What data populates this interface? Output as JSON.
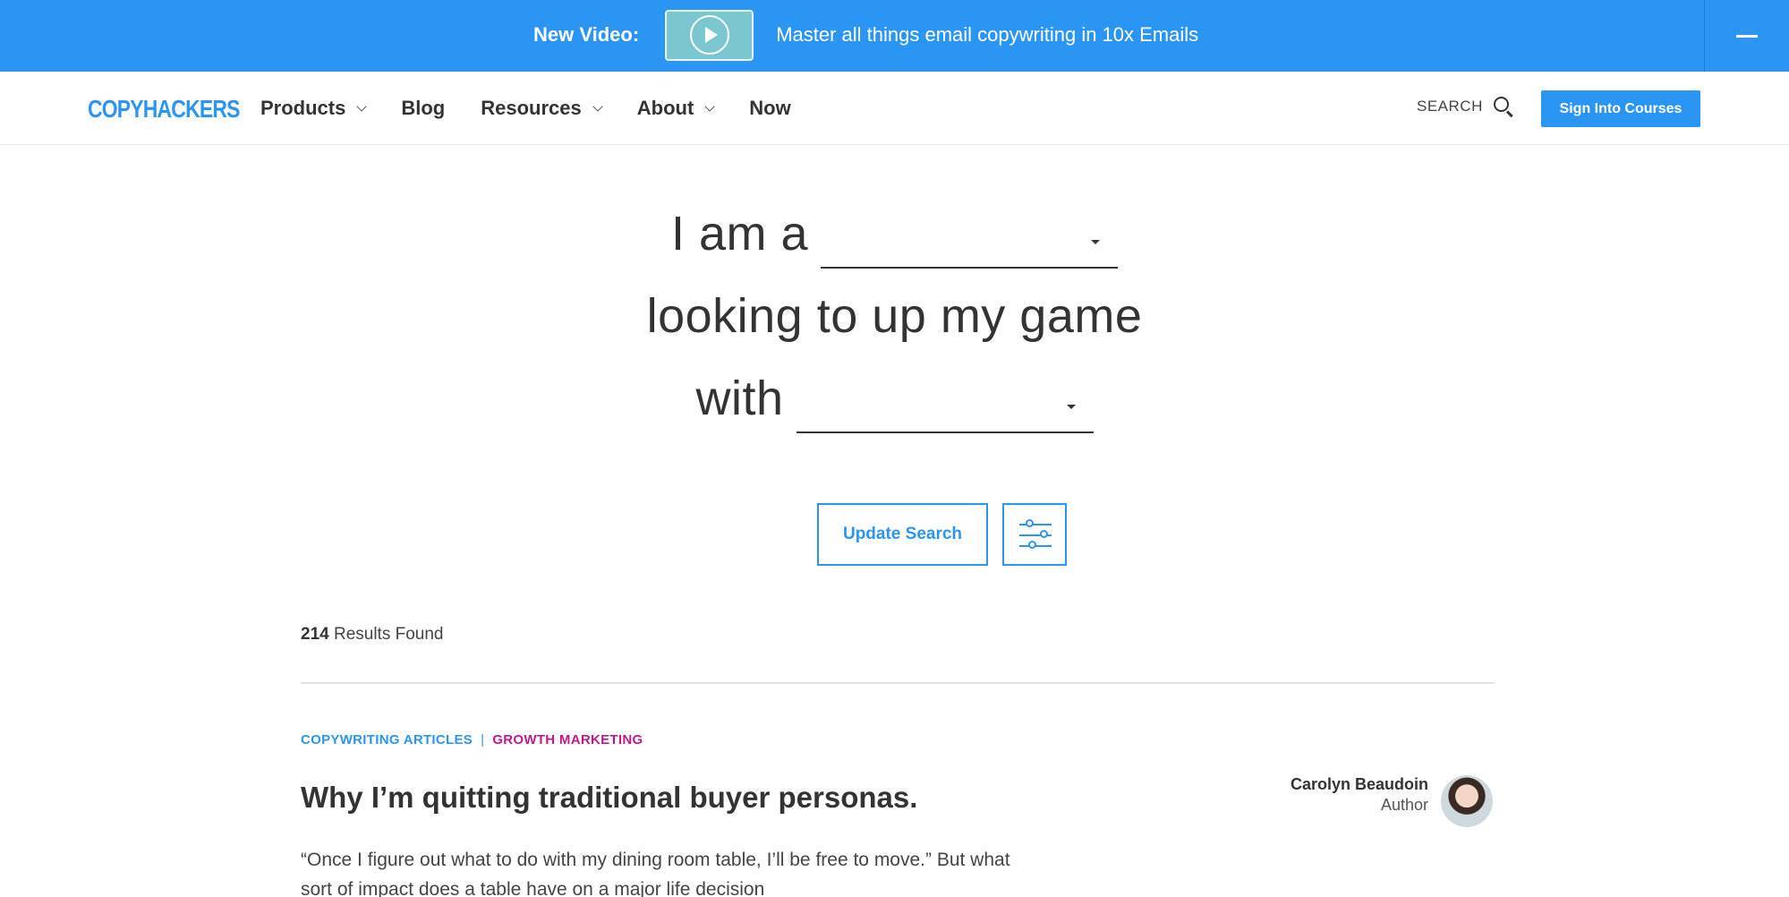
{
  "promo": {
    "label": "New Video:",
    "text": "Master all things email copywriting in 10x Emails"
  },
  "nav": {
    "logo": "COPYHACKERS",
    "links": [
      {
        "label": "Products",
        "has_dropdown": true
      },
      {
        "label": "Blog",
        "has_dropdown": false
      },
      {
        "label": "Resources",
        "has_dropdown": true
      },
      {
        "label": "About",
        "has_dropdown": true
      },
      {
        "label": "Now",
        "has_dropdown": false
      }
    ],
    "search_label": "SEARCH",
    "signin_label": "Sign Into Courses"
  },
  "finder": {
    "line1_prefix": "I am a",
    "line1_select_value": "",
    "line2": "looking to up my game",
    "line3_prefix": "with",
    "line3_select_value": "",
    "update_label": "Update Search"
  },
  "results": {
    "count": "214",
    "count_suffix": " Results Found"
  },
  "post": {
    "tags": [
      "COPYWRITING ARTICLES",
      "GROWTH MARKETING"
    ],
    "tag_separator": "|",
    "title": "Why I’m quitting traditional buyer personas.",
    "author_name": "Carolyn Beaudoin",
    "author_role": "Author",
    "excerpt": "“Once I figure out what to do with my dining room table, I’ll be free to move.” But what sort of impact does a table have on a major life decision"
  },
  "colors": {
    "accent": "#2b95f3",
    "tag_secondary": "#c0198a",
    "text": "#333333"
  }
}
